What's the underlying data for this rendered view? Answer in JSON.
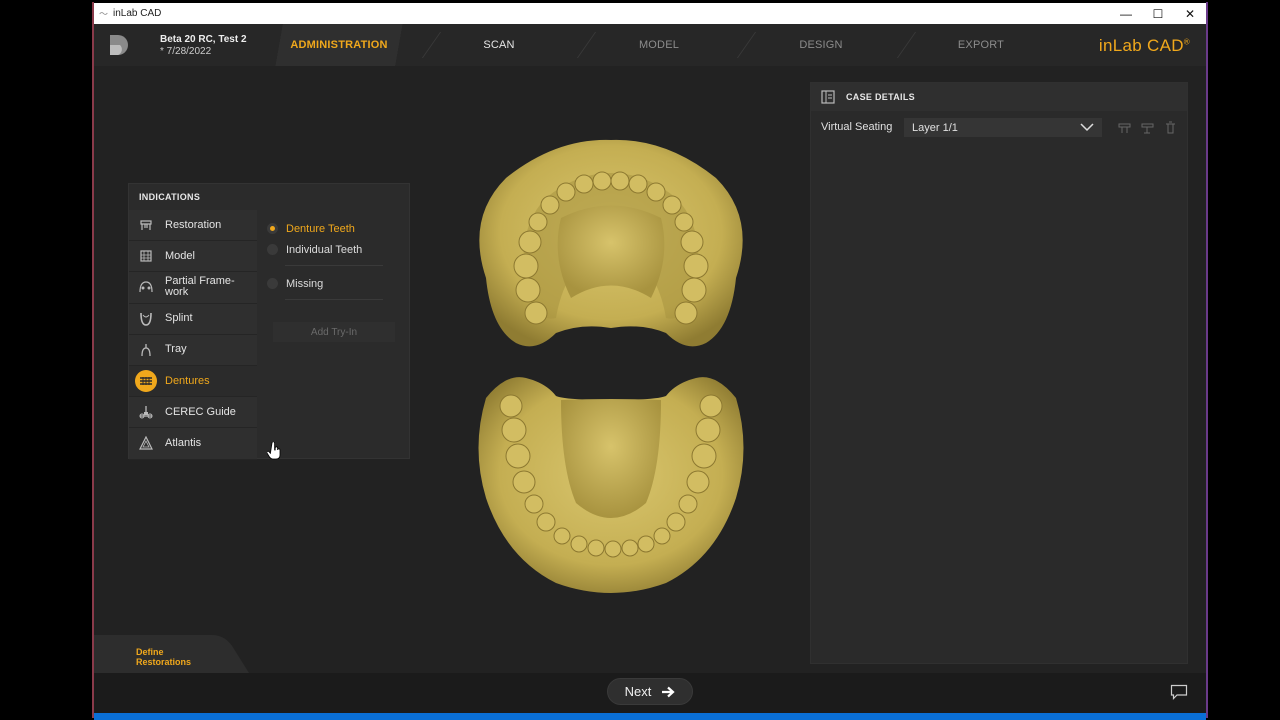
{
  "window": {
    "title": "inLab CAD"
  },
  "header": {
    "case_name": "Beta 20 RC, Test 2",
    "case_date": "* 7/28/2022",
    "brand": "inLab CAD",
    "brand_mark": "®",
    "steps": [
      {
        "label": "ADMINISTRATION",
        "state": "active"
      },
      {
        "label": "SCAN",
        "state": "enabled"
      },
      {
        "label": "MODEL",
        "state": "disabled"
      },
      {
        "label": "DESIGN",
        "state": "disabled"
      },
      {
        "label": "EXPORT",
        "state": "disabled"
      }
    ]
  },
  "indications": {
    "title": "INDICATIONS",
    "items": [
      {
        "label": "Restoration",
        "icon": "restoration-icon"
      },
      {
        "label": "Model",
        "icon": "model-icon"
      },
      {
        "label": "Partial Frame-\nwork",
        "icon": "partial-framework-icon"
      },
      {
        "label": "Splint",
        "icon": "splint-icon"
      },
      {
        "label": "Tray",
        "icon": "tray-icon"
      },
      {
        "label": "Dentures",
        "icon": "dentures-icon",
        "selected": true
      },
      {
        "label": "CEREC Guide",
        "icon": "cerec-guide-icon"
      },
      {
        "label": "Atlantis",
        "icon": "atlantis-icon"
      }
    ],
    "options": [
      {
        "label": "Denture Teeth",
        "selected": true
      },
      {
        "label": "Individual Teeth",
        "selected": false
      },
      {
        "label": "Missing",
        "selected": false
      }
    ],
    "add_tryin_label": "Add Try-In"
  },
  "case_details": {
    "title": "CASE DETAILS",
    "virtual_seating_label": "Virtual Seating",
    "layer_value": "Layer 1/1"
  },
  "footer": {
    "step_label_line1": "Define",
    "step_label_line2": "Restorations",
    "next_label": "Next"
  },
  "colors": {
    "accent": "#f0a81c",
    "background": "#222222",
    "model": "#c9b45a"
  }
}
